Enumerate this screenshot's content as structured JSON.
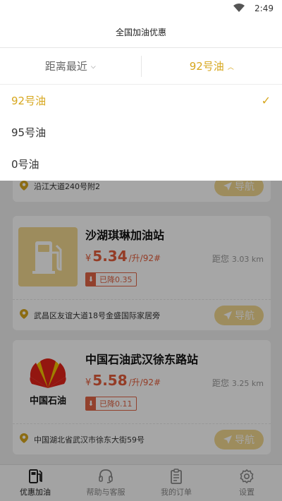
{
  "status_bar": {
    "time": "2:49"
  },
  "header": {
    "title": "全国加油优惠"
  },
  "filter": {
    "sort_label": "距离最近",
    "fuel_label": "92号油"
  },
  "dropdown": {
    "items": [
      {
        "label": "92号油"
      },
      {
        "label": "95号油"
      },
      {
        "label": "0号油"
      }
    ]
  },
  "stations": [
    {
      "address": "沿江大道240号附2",
      "nav_label": "导航"
    },
    {
      "name": "沙湖琪琳加油站",
      "currency": "¥",
      "price": "5.34",
      "unit": "/升/92#",
      "distance_label": "距您",
      "distance": "3.03 km",
      "discount": "已降0.35",
      "address": "武昌区友谊大道18号金盛国际家居旁",
      "nav_label": "导航"
    },
    {
      "name": "中国石油武汉徐东路站",
      "logo_text": "中国石油",
      "currency": "¥",
      "price": "5.58",
      "unit": "/升/92#",
      "distance_label": "距您",
      "distance": "3.25 km",
      "discount": "已降0.11",
      "address": "中国湖北省武汉市徐东大街59号",
      "nav_label": "导航"
    }
  ],
  "tabs": [
    {
      "label": "优惠加油",
      "icon": "fuel-pump-icon"
    },
    {
      "label": "帮助与客服",
      "icon": "headset-icon"
    },
    {
      "label": "我的订单",
      "icon": "clipboard-icon"
    },
    {
      "label": "设置",
      "icon": "gear-icon"
    }
  ],
  "colors": {
    "accent": "#d7a71e",
    "price": "#e35c3b",
    "nav_button": "#f2d890"
  }
}
